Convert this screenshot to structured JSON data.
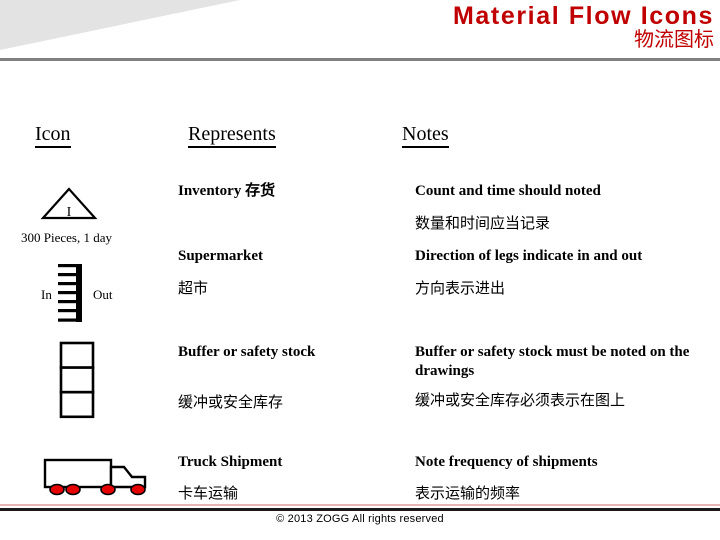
{
  "header": {
    "title_en": "Material Flow Icons",
    "title_zh": "物流图标",
    "title_color": "#c00000",
    "rule_color": "#808080",
    "wedge_color": "#e3e3e3"
  },
  "table": {
    "columns": [
      {
        "key": "icon",
        "label": "Icon"
      },
      {
        "key": "represents",
        "label": "Represents"
      },
      {
        "key": "notes",
        "label": "Notes"
      }
    ],
    "rows": [
      {
        "icon_name": "inventory-triangle-icon",
        "icon_label": "I",
        "icon_caption": "300 Pieces, 1 day",
        "represents_en": "Inventory 存货",
        "represents_zh": "",
        "notes_en": "Count and time should noted",
        "notes_zh": "数量和时间应当记录"
      },
      {
        "icon_name": "supermarket-icon",
        "icon_in_label": "In",
        "icon_out_label": "Out",
        "represents_en": "Supermarket",
        "represents_zh": "超市",
        "notes_en": "Direction of legs indicate in and out",
        "notes_zh": "方向表示进出"
      },
      {
        "icon_name": "buffer-stack-icon",
        "represents_en": "Buffer or safety stock",
        "represents_zh": "缓冲或安全库存",
        "notes_en": "Buffer or safety stock must be noted on the drawings",
        "notes_zh": "缓冲或安全库存必须表示在图上"
      },
      {
        "icon_name": "truck-shipment-icon",
        "represents_en": "Truck Shipment",
        "represents_zh": "卡车运输",
        "notes_en": "Note frequency of shipments",
        "notes_zh": "表示运输的频率"
      }
    ]
  },
  "icons": {
    "truck_wheel_color": "#e60000",
    "stroke_color": "#000000"
  },
  "footer": {
    "copyright": "© 2013 ZOGG  All rights reserved",
    "rule_red": "#e8b4b4",
    "rule_black": "#1a1a1a"
  }
}
